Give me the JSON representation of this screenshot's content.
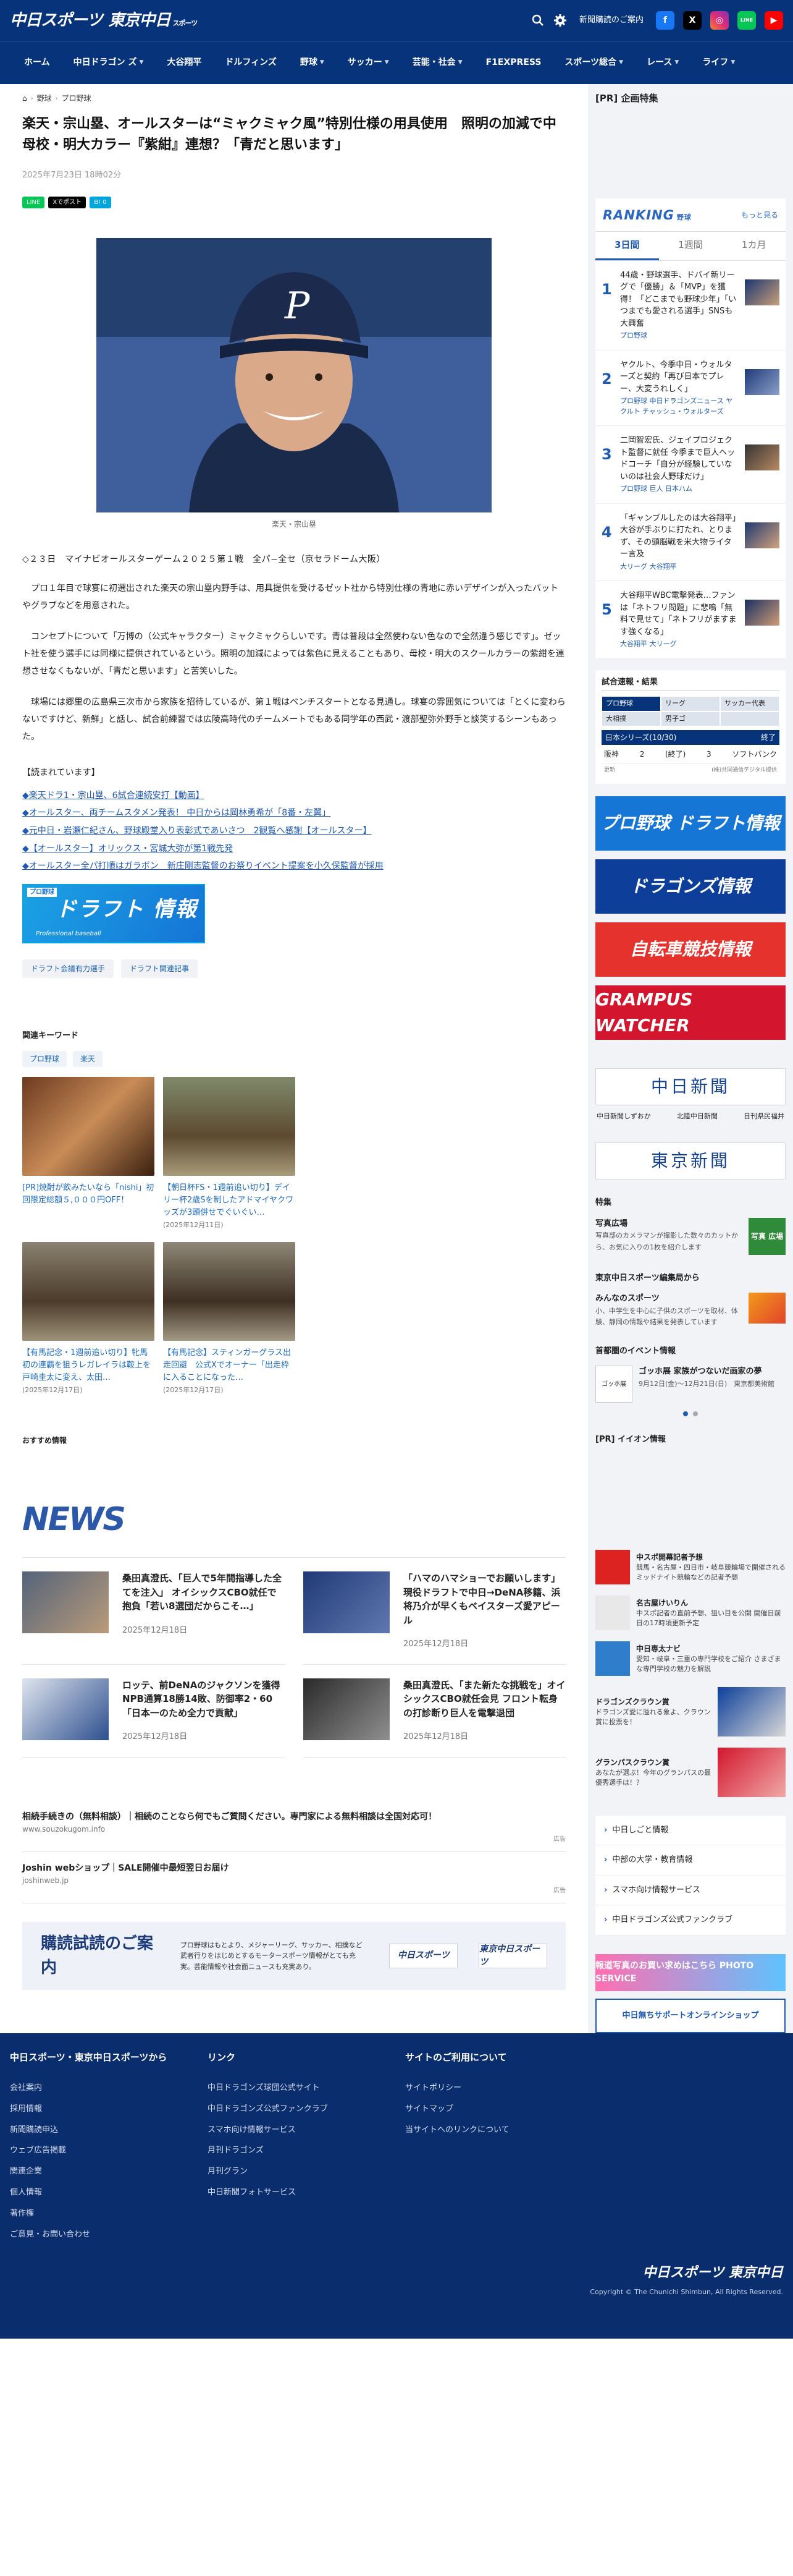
{
  "header": {
    "logo_primary": "中日スポーツ",
    "logo_secondary": "東京中日",
    "logo_small": "スポーツ",
    "subscribe_label": "新聞購読のご案内",
    "sns": [
      "f",
      "X",
      "◎",
      "LINE",
      "▶"
    ]
  },
  "nav": [
    {
      "label": "ホーム",
      "caret": false
    },
    {
      "label": "中日ドラゴン ズ",
      "caret": true
    },
    {
      "label": "大谷翔平",
      "caret": false
    },
    {
      "label": "ドルフィンズ",
      "caret": false
    },
    {
      "label": "野球",
      "caret": true
    },
    {
      "label": "サッカー",
      "caret": true
    },
    {
      "label": "芸能・社会",
      "caret": true
    },
    {
      "label": "F1EXPRESS",
      "caret": false
    },
    {
      "label": "スポーツ総合",
      "caret": true
    },
    {
      "label": "レース",
      "caret": true
    },
    {
      "label": "ライフ",
      "caret": true
    }
  ],
  "breadcrumb": [
    "野球",
    "プロ野球"
  ],
  "article": {
    "title": "楽天・宗山塁、オールスターは“ミャクミャク風”特別仕様の用具使用　照明の加減で中母校・明大カラー『紫紺』連想？「青だと思います」",
    "date": "2025年7月23日 18時02分",
    "share": [
      "LINE",
      "Xでポスト",
      "B! 0"
    ],
    "photo_caption": "楽天・宗山塁",
    "lead": "◇２３日　マイナビオールスターゲーム２０２５第１戦　全パ−全セ（京セラドーム大阪）",
    "paragraphs": [
      "プロ１年目で球宴に初選出された楽天の宗山塁内野手は、用具提供を受けるゼット社から特別仕様の青地に赤いデザインが入ったバットやグラブなどを用意された。",
      "コンセプトについて「万博の（公式キャラクター）ミャクミャクらしいです。青は普段は全然使わない色なので全然違う感じです」。ゼット社を使う選手には同様に提供されているという。照明の加減によっては紫色に見えることもあり、母校・明大のスクールカラーの紫紺を連想させなくもないが、「青だと思います」と苦笑いした。",
      "球場には郷里の広島県三次市から家族を招待しているが、第１戦はベンチスタートとなる見通し。球宴の雰囲気については「とくに変わらないですけど、新鮮」と話し、試合前練習では広陵高時代のチームメートでもある同学年の西武・渡部聖弥外野手と談笑するシーンもあった。"
    ],
    "related_heading": "【読まれています】",
    "related_links": [
      "◆楽天ドラ1・宗山塁、6試合連続安打【動画】",
      "◆オールスター、両チームスタメン発表！ 中日からは岡林勇希が「8番・左翼」",
      "◆元中日・岩瀬仁紀さん、野球殿堂入り表彰式であいさつ　2観覧へ感謝【オールスター】",
      "◆【オールスター】オリックス・宮城大弥が第1戦先発",
      "◆オールスター全パ打順はガラボン　新庄剛志監督のお祭りイベント提案を小久保監督が採用"
    ],
    "draft_banner": {
      "small": "プロ野球",
      "big": "ドラフト 情報",
      "sub": "Professional baseball"
    },
    "tags": [
      "ドラフト会議有力選手",
      "ドラフト関連記事"
    ]
  },
  "keywords": {
    "heading": "関連キーワード",
    "items": [
      "プロ野球",
      "楽天"
    ]
  },
  "cards": [
    {
      "title": "[PR]焼酎が飲みたいなら「nishi」初回限定総額５,０００円OFF！",
      "date": ""
    },
    {
      "title": "【朝日杯FS・1週前追い切り】デイリー杯2歳Sを制したアドマイヤクワッズが3頭併せでぐいぐい…",
      "date": "(2025年12月11日)"
    },
    {
      "title": "【有馬記念・1週前追い切り】牝馬初の連覇を狙うレガレイラは鞍上を戸崎圭太に変え、太田…",
      "date": "(2025年12月17日)"
    },
    {
      "title": "【有馬記念】スティンガーグラス出走回避　公式Xでオーナー「出走枠に入ることになった…",
      "date": "(2025年12月17日)"
    }
  ],
  "recommend_heading": "おすすめ情報",
  "news_logo": "NEWS",
  "news": [
    {
      "title": "桑田真澄氏、「巨人で5年間指導した全てを注入」 オイシックスCBO就任で抱負「若い8選団だからこそ…」",
      "date": "2025年12月18日"
    },
    {
      "title": "「ハマのハマショーでお願いします」現役ドラフトで中日→DeNA移籍、浜将乃介が早くもベイスターズ愛アピール",
      "date": "2025年12月18日"
    },
    {
      "title": "ロッテ、前DeNAのジャクソンを獲得 NPB通算18勝14敗、防御率2・60「日本一のため全力で貢献」",
      "date": "2025年12月18日"
    },
    {
      "title": "桑田真澄氏、「また新たな挑戦を」オイシックスCBO就任会見 フロント転身の打診断り巨人を電撃退団",
      "date": "2025年12月18日"
    }
  ],
  "ads": [
    {
      "title": "相続手続きの（無料相談）｜相続のことなら何でもご質問ください。専門家による無料相談は全国対応可！",
      "url": "www.souzokugom.info",
      "tag": "広告"
    },
    {
      "title": "Joshin webショップ｜SALE開催中最短翌日お届け",
      "url": "joshinweb.jp",
      "tag": "広告"
    }
  ],
  "subscription": {
    "heading": "購読試読のご案内",
    "text": "プロ野球はもとより、メジャーリーグ、サッカー、相撲など武者行りをはじめとするモータースポーツ情報がとても充実。芸能情報や社会面ニュースも充実あり。",
    "logos": [
      "中日スポーツ",
      "東京中日スポーツ"
    ]
  },
  "side": {
    "pr_heading": "[PR] 企画特集",
    "ranking": {
      "title": "RANKING",
      "subtitle": "野球",
      "more": "もっと見る",
      "tabs": [
        "3日間",
        "1週間",
        "1カ月"
      ],
      "items": [
        {
          "n": "1",
          "title": "44歳・野球選手、ドバイ新リーグで「優勝」＆「MVP」を獲得！「どこまでも野球少年」「いつまでも愛される選手」SNSも大興奮",
          "meta": "プロ野球"
        },
        {
          "n": "2",
          "title": "ヤクルト、今季中日・ウォルターズと契約「再び日本でプレー、大変うれしく」",
          "meta": "プロ野球 中日ドラゴンズニュース ヤクルト チャッシュ・ウォルターズ"
        },
        {
          "n": "3",
          "title": "二岡智宏氏、ジェイプロジェクト監督に就任 今季まで巨人ヘッドコーチ「自分が経験していないのは社会人野球だけ」",
          "meta": "プロ野球 巨人 日本ハム"
        },
        {
          "n": "4",
          "title": "「ギャンブルしたのは大谷翔平」大谷が手ぶりに打たれ、とりまず、その頭脳戦を米大物ライター言及",
          "meta": "大リーグ 大谷翔平"
        },
        {
          "n": "5",
          "title": "大谷翔平WBC電撃発表…ファンは「ネトフリ問題」に悲鳴「無料で見せて」「ネトフリがますます強くなる」",
          "meta": "大谷翔平 大リーグ"
        }
      ]
    },
    "score": {
      "heading": "試合速報・結果",
      "leagues": [
        "プロ野球",
        "リーグ",
        "サッカー代表",
        "大相撲",
        "男子ゴ",
        ""
      ],
      "series": "日本シリーズ(10/30)",
      "series_right": "終了",
      "row": {
        "home": "阪神",
        "hs": "2",
        "mid": "(終了)",
        "as": "3",
        "away": "ソフトバンク"
      },
      "foot_left": "更新",
      "foot_right": "(株)共同通信デジタル提供"
    },
    "banners": [
      {
        "label": "プロ野球 ドラフト情報",
        "bg": "#1676d6"
      },
      {
        "label": "ドラゴンズ情報",
        "bg": "#0d3f9a"
      },
      {
        "label": "自転車競技情報",
        "bg": "#e5322d"
      },
      {
        "label": "GRAMPUS WATCHER",
        "bg": "#d3162d"
      }
    ],
    "paper1": "中日新聞",
    "paper_links": [
      "中日新聞しずおか",
      "北陸中日新聞",
      "日刊県民福井"
    ],
    "paper2": "東京新聞",
    "feature_heading": "特集",
    "feature": {
      "title": "写真広場",
      "desc": "写真部のカメラマンが撮影した数々のカットから、お気に入りの1枚を紹介します",
      "thumb": "写真 広場"
    },
    "kids_heading": "東京中日スポーツ編集局から",
    "kids": {
      "title": "みんなのスポーツ",
      "desc": "小、中学生を中心に子供のスポーツを取材、体験、静岡の情報や結果を発表しています"
    },
    "event_heading": "首都圏のイベント情報",
    "event": {
      "title": "ゴッホ展 家族がつないだ画家の夢",
      "desc": "9月12日(金)〜12月21日(日)　東京都美術館"
    },
    "iiion_heading": "[PR] イイオン情報",
    "side_ads": [
      {
        "title": "中スポ開幕記者予想",
        "desc": "競馬・名古屋・四日市・岐阜競輪場で開催されるミッドナイト競輪などの記者予想"
      },
      {
        "title": "名古屋けいりん",
        "desc": "中スポ記者の直前予想、狙い目を公開 開催日前日の17時頃更新予定"
      },
      {
        "title": "中日専太ナビ",
        "desc": "愛知・岐阜・三重の専門学校をご紹介 さまざまな専門学校の魅力を解説"
      },
      {
        "title": "ドラゴンズクラウン賞",
        "desc": "ドラゴンズ愛に溢れる象よ、クラウン賞に投票を！"
      },
      {
        "title": "グランパスクラウン賞",
        "desc": "あなたが選ぶ！今年のグランパスの最優秀選手は！？"
      }
    ],
    "links": [
      "中日しごと情報",
      "中部の大学・教育情報",
      "スマホ向け情報サービス",
      "中日ドラゴンズ公式ファンクラブ"
    ],
    "photo_banner": "報道写真のお買い求めはこちら PHOTO SERVICE",
    "shop_banner": "中日無ちサポートオンラインショップ"
  },
  "footer": {
    "cols": [
      {
        "heading": "中日スポーツ・東京中日スポーツから",
        "items": [
          "会社案内",
          "採用情報",
          "新聞購読申込",
          "ウェブ広告掲載",
          "関連企業",
          "個人情報",
          "著作権",
          "ご意見・お問い合わせ"
        ]
      },
      {
        "heading": "リンク",
        "items": [
          "中日ドラゴンズ球団公式サイト",
          "中日ドラゴンズ公式ファンクラブ",
          "スマホ向け情報サービス",
          "月刊ドラゴンズ",
          "月刊グラン",
          "中日新聞フォトサービス"
        ]
      },
      {
        "heading": "サイトのご利用について",
        "items": [
          "サイトポリシー",
          "サイトマップ",
          "当サイトへのリンクについて"
        ]
      }
    ],
    "logo": "中日スポーツ 東京中日",
    "copyright": "Copyright © The Chunichi Shimbun, All Rights Reserved."
  }
}
